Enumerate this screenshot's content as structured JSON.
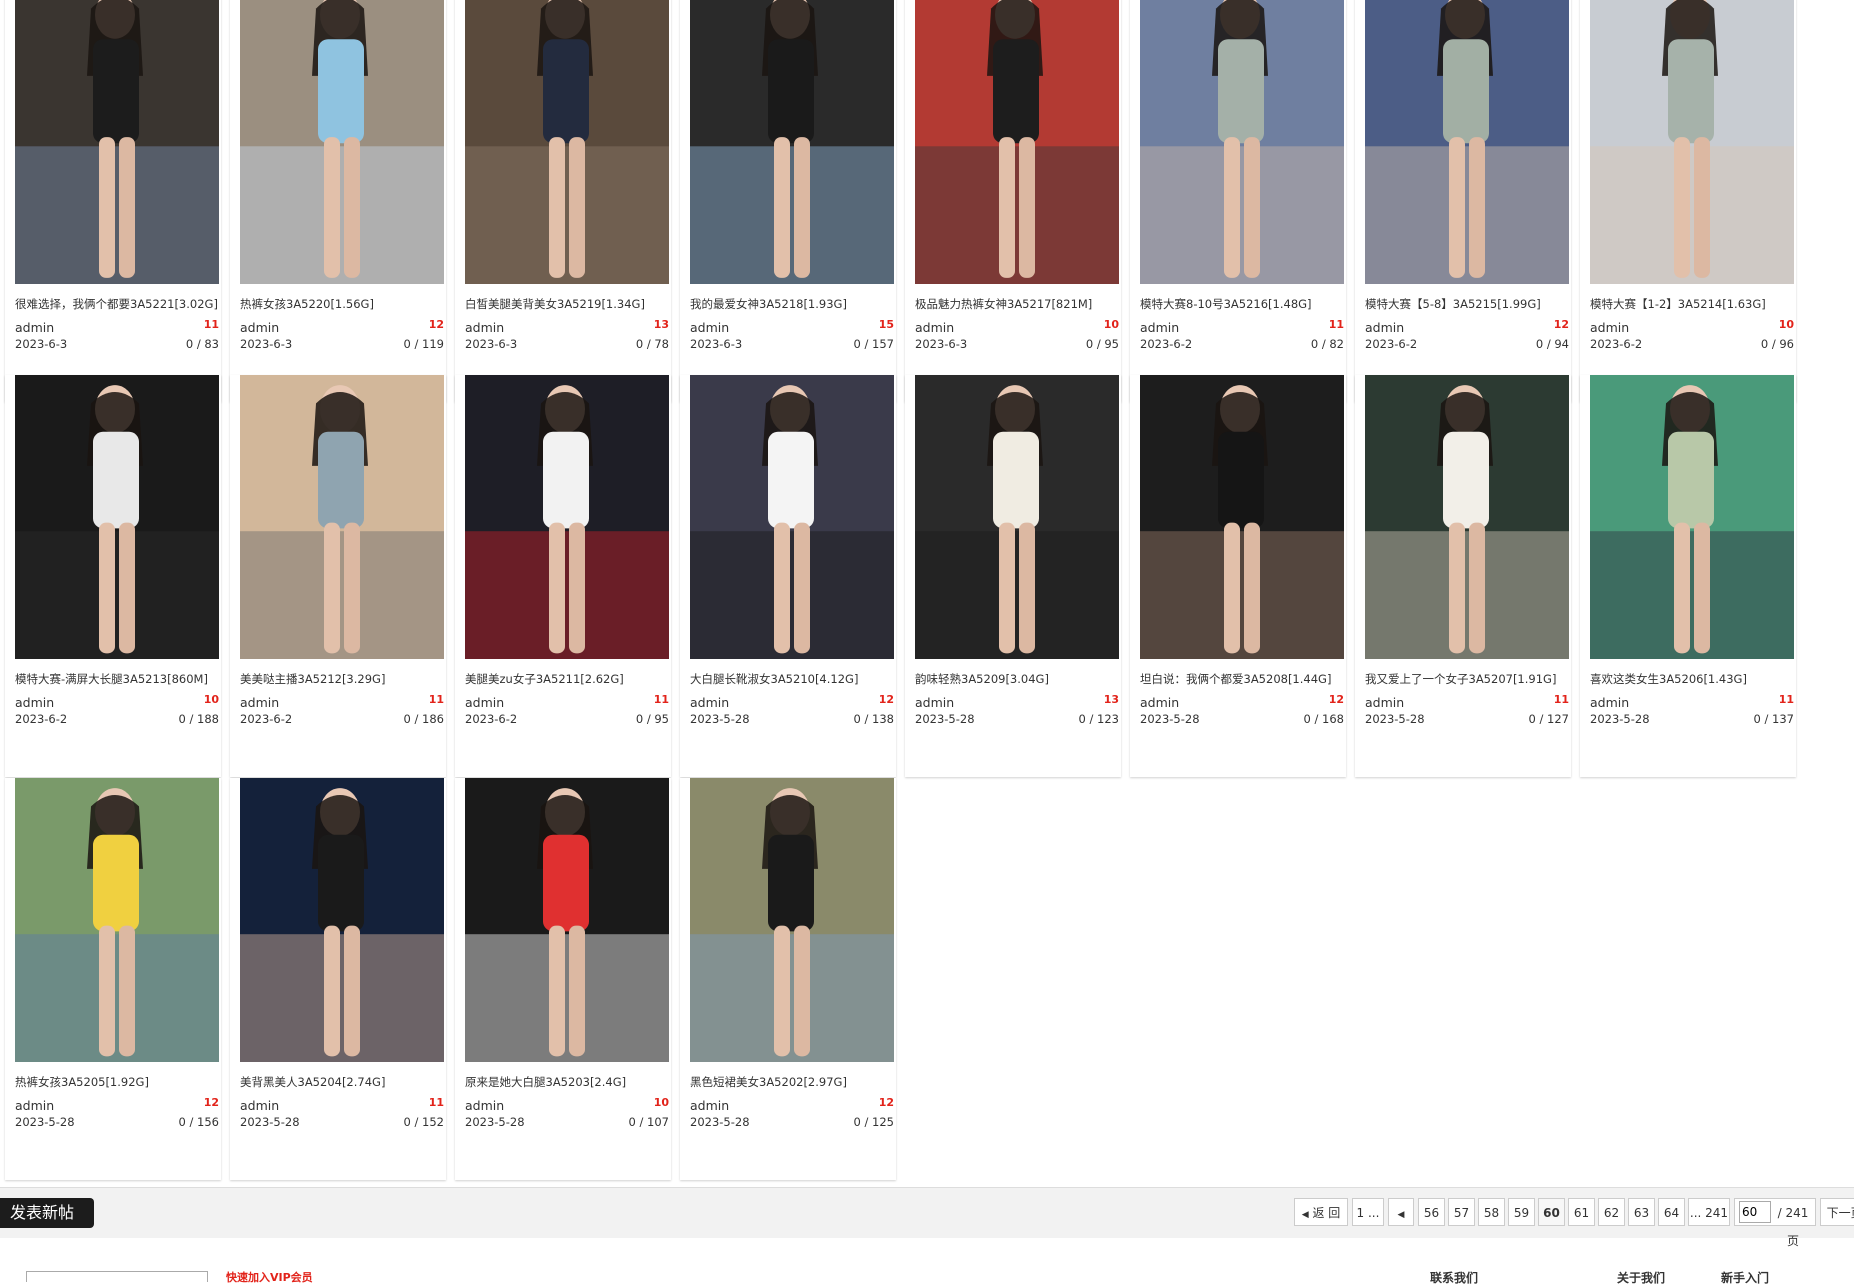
{
  "posts": [
    {
      "title": "很难选择，我俩个都要3A5221[3.02G]",
      "author": "admin",
      "count": "11",
      "date": "2023-6-3",
      "stats": "0 / 83"
    },
    {
      "title": "热裤女孩3A5220[1.56G]",
      "author": "admin",
      "count": "12",
      "date": "2023-6-3",
      "stats": "0 / 119"
    },
    {
      "title": "白皙美腿美背美女3A5219[1.34G]",
      "author": "admin",
      "count": "13",
      "date": "2023-6-3",
      "stats": "0 / 78"
    },
    {
      "title": "我的最爱女神3A5218[1.93G]",
      "author": "admin",
      "count": "15",
      "date": "2023-6-3",
      "stats": "0 / 157"
    },
    {
      "title": "极品魅力热裤女神3A5217[821M]",
      "author": "admin",
      "count": "10",
      "date": "2023-6-3",
      "stats": "0 / 95"
    },
    {
      "title": "模特大赛8-10号3A5216[1.48G]",
      "author": "admin",
      "count": "11",
      "date": "2023-6-2",
      "stats": "0 / 82"
    },
    {
      "title": "模特大赛【5-8】3A5215[1.99G]",
      "author": "admin",
      "count": "12",
      "date": "2023-6-2",
      "stats": "0 / 94"
    },
    {
      "title": "模特大赛【1-2】3A5214[1.63G]",
      "author": "admin",
      "count": "10",
      "date": "2023-6-2",
      "stats": "0 / 96"
    },
    {
      "title": "模特大赛-满屏大长腿3A5213[860M]",
      "author": "admin",
      "count": "10",
      "date": "2023-6-2",
      "stats": "0 / 188"
    },
    {
      "title": "美美哒主播3A5212[3.29G]",
      "author": "admin",
      "count": "11",
      "date": "2023-6-2",
      "stats": "0 / 186"
    },
    {
      "title": "美腿美zu女子3A5211[2.62G]",
      "author": "admin",
      "count": "11",
      "date": "2023-6-2",
      "stats": "0 / 95"
    },
    {
      "title": "大白腿长靴淑女3A5210[4.12G]",
      "author": "admin",
      "count": "12",
      "date": "2023-5-28",
      "stats": "0 / 138"
    },
    {
      "title": "韵味轻熟3A5209[3.04G]",
      "author": "admin",
      "count": "13",
      "date": "2023-5-28",
      "stats": "0 / 123"
    },
    {
      "title": "坦白说：我俩个都爱3A5208[1.44G]",
      "author": "admin",
      "count": "12",
      "date": "2023-5-28",
      "stats": "0 / 168"
    },
    {
      "title": "我又爱上了一个女子3A5207[1.91G]",
      "author": "admin",
      "count": "11",
      "date": "2023-5-28",
      "stats": "0 / 127"
    },
    {
      "title": "喜欢这类女生3A5206[1.43G]",
      "author": "admin",
      "count": "11",
      "date": "2023-5-28",
      "stats": "0 / 137"
    },
    {
      "title": "热裤女孩3A5205[1.92G]",
      "author": "admin",
      "count": "12",
      "date": "2023-5-28",
      "stats": "0 / 156"
    },
    {
      "title": "美背黑美人3A5204[2.74G]",
      "author": "admin",
      "count": "11",
      "date": "2023-5-28",
      "stats": "0 / 152"
    },
    {
      "title": "原来是她大白腿3A5203[2.4G]",
      "author": "admin",
      "count": "10",
      "date": "2023-5-28",
      "stats": "0 / 107"
    },
    {
      "title": "黑色短裙美女3A5202[2.97G]",
      "author": "admin",
      "count": "12",
      "date": "2023-5-28",
      "stats": "0 / 125"
    }
  ],
  "thumb_colors": [
    [
      "#3a3530",
      "#1c1c1c",
      "#7a8fb0"
    ],
    [
      "#9b8f80",
      "#8fc3e0",
      "#c8d6e8"
    ],
    [
      "#5a4a3c",
      "#232b3e",
      "#8b7a68"
    ],
    [
      "#2a2a2a",
      "#1a1a1a",
      "#8fb3d6"
    ],
    [
      "#b33a33",
      "#1d1d1d",
      "#3a3a3a"
    ],
    [
      "#6f7fa0",
      "#a4b0a8",
      "#c9b8a8"
    ],
    [
      "#4c5d86",
      "#a2afa4",
      "#d0bfb0"
    ],
    [
      "#c8ccd2",
      "#a6b2aa",
      "#d8c6b6"
    ],
    [
      "#1a1a1a",
      "#e8e8e8",
      "#2a2a2a"
    ],
    [
      "#d2b79a",
      "#8fa4b0",
      "#6d6d6d"
    ],
    [
      "#1e1e26",
      "#f2f2f2",
      "#c81e2a"
    ],
    [
      "#3a3a4a",
      "#f4f4f4",
      "#1b1b1b"
    ],
    [
      "#2a2a2a",
      "#f0ece2",
      "#1a1a1a"
    ],
    [
      "#1d1d1d",
      "#151515",
      "#9a7a68"
    ],
    [
      "#2c3a32",
      "#f2efe8",
      "#cfc6b6"
    ],
    [
      "#4a9a7a",
      "#b8c8a8",
      "#2f3640"
    ],
    [
      "#7a9a6a",
      "#f0d040",
      "#5a7aa8"
    ],
    [
      "#14213a",
      "#1a1a1a",
      "#d8b4a0"
    ],
    [
      "#1a1a1a",
      "#e03030",
      "#f4f4f4"
    ],
    [
      "#8a8a6a",
      "#1a1a1a",
      "#7a9ac0"
    ]
  ],
  "post_button": "发表新帖",
  "pagination": {
    "back": "返 回",
    "first": "1 ...",
    "pages": [
      "56",
      "57",
      "58",
      "59",
      "60",
      "61",
      "62",
      "63",
      "64"
    ],
    "current": "60",
    "last": "... 241",
    "input_value": "60",
    "total": "/ 241 页",
    "next": "下一页"
  },
  "footer": {
    "notice": "快速加入VIP会员",
    "links": [
      "联系我们",
      "关于我们",
      "新手入门"
    ]
  }
}
